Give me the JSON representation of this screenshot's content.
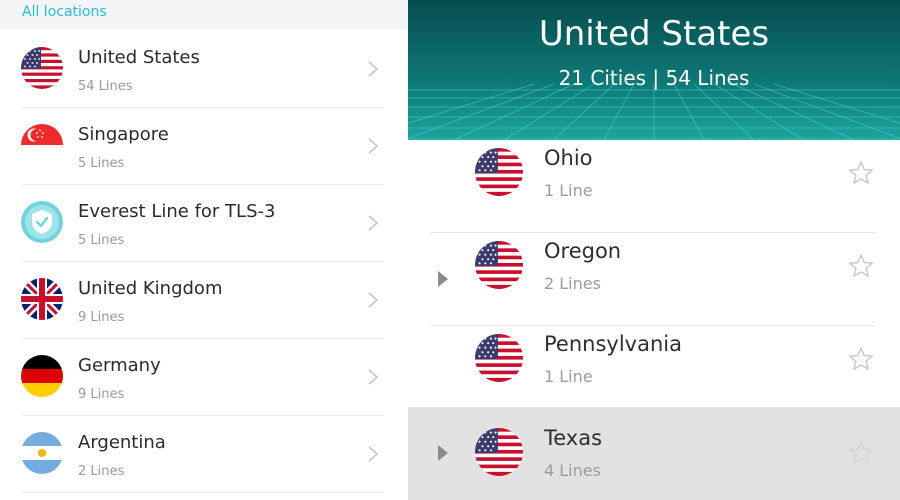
{
  "left_panel": {
    "header": "All locations",
    "items": [
      {
        "name": "United States",
        "lines": "54 Lines",
        "flag": "us-flag-icon"
      },
      {
        "name": "Singapore",
        "lines": "5 Lines",
        "flag": "singapore-flag-icon"
      },
      {
        "name": "Everest Line for TLS-3",
        "lines": "5 Lines",
        "flag": "shield-icon"
      },
      {
        "name": "United Kingdom",
        "lines": "9 Lines",
        "flag": "uk-flag-icon"
      },
      {
        "name": "Germany",
        "lines": "9 Lines",
        "flag": "germany-flag-icon"
      },
      {
        "name": "Argentina",
        "lines": "2 Lines",
        "flag": "argentina-flag-icon"
      }
    ]
  },
  "right_panel": {
    "title": "United States",
    "subtitle": "21 Cities | 54 Lines",
    "cities": [
      {
        "name": "Ohio",
        "lines": "1 Line",
        "expandable": false,
        "selected": false
      },
      {
        "name": "Oregon",
        "lines": "2 Lines",
        "expandable": true,
        "selected": false
      },
      {
        "name": "Pennsylvania",
        "lines": "1 Line",
        "expandable": false,
        "selected": false
      },
      {
        "name": "Texas",
        "lines": "4 Lines",
        "expandable": true,
        "selected": true
      }
    ]
  },
  "colors": {
    "accent": "#23c0cf",
    "banner_dark": "#074c4f",
    "banner_light": "#1ea39c",
    "selected_row": "#e2e2e2"
  }
}
